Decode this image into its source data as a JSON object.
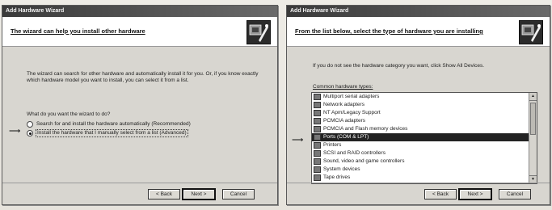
{
  "left_window": {
    "title": "Add Hardware Wizard",
    "header_title": "The wizard can help you install other hardware",
    "description": "The wizard can search for other hardware and automatically install it for you. Or, if you know exactly which hardware model you want to install, you can select it from a list.",
    "question": "What do you want the wizard to do?",
    "options": [
      {
        "label": "Search for and install the hardware automatically (Recommended)",
        "selected": false
      },
      {
        "label": "Install the hardware that I manually select from a list (Advanced)",
        "selected": true
      }
    ],
    "buttons": {
      "back": "< Back",
      "next": "Next >",
      "cancel": "Cancel"
    }
  },
  "right_window": {
    "title": "Add Hardware Wizard",
    "header_title": "From the list below, select the type of hardware you are installing",
    "prompt": "If you do not see the hardware category you want, click Show All Devices.",
    "list_label": "Common hardware types:",
    "items": [
      {
        "label": "Multiport serial adapters",
        "selected": false
      },
      {
        "label": "Network adapters",
        "selected": false
      },
      {
        "label": "NT Apm/Legacy Support",
        "selected": false
      },
      {
        "label": "PCMCIA adapters",
        "selected": false
      },
      {
        "label": "PCMCIA and Flash memory devices",
        "selected": false
      },
      {
        "label": "Ports (COM & LPT)",
        "selected": true
      },
      {
        "label": "Printers",
        "selected": false
      },
      {
        "label": "SCSI and RAID controllers",
        "selected": false
      },
      {
        "label": "Sound, video and game controllers",
        "selected": false
      },
      {
        "label": "System devices",
        "selected": false
      },
      {
        "label": "Tape drives",
        "selected": false
      }
    ],
    "buttons": {
      "back": "< Back",
      "next": "Next >",
      "cancel": "Cancel"
    }
  }
}
